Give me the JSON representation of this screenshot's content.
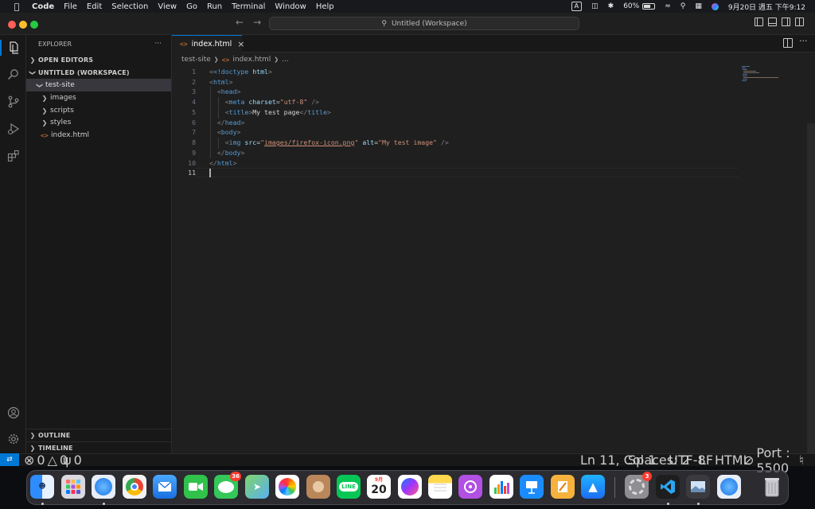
{
  "menubar": {
    "app": "Code",
    "items": [
      "File",
      "Edit",
      "Selection",
      "View",
      "Go",
      "Run",
      "Terminal",
      "Window",
      "Help"
    ],
    "input_source": "A",
    "battery": "60%",
    "datetime": "9月20日 週五 下午9:12"
  },
  "window": {
    "title": "Untitled (Workspace)"
  },
  "sidebar": {
    "title": "EXPLORER",
    "open_editors": "OPEN EDITORS",
    "workspace": "UNTITLED (WORKSPACE)",
    "tree": {
      "root": "test-site",
      "folders": [
        "images",
        "scripts",
        "styles"
      ],
      "file": "index.html"
    },
    "outline": "OUTLINE",
    "timeline": "TIMELINE"
  },
  "editor": {
    "tab": "index.html",
    "breadcrumb": {
      "folder": "test-site",
      "file": "index.html",
      "more": "..."
    },
    "line_numbers": [
      "1",
      "2",
      "3",
      "4",
      "5",
      "6",
      "7",
      "8",
      "9",
      "10",
      "11"
    ],
    "code": {
      "l1a": "<!doctype ",
      "l1b": "html",
      "l1c": ">",
      "l2": "html",
      "l3": "head",
      "l4_tag": "meta",
      "l4_attr": "charset",
      "l4_val": "\"utf-8\"",
      "l4_end": " />",
      "l5_tag": "title",
      "l5_text": "My test page",
      "l6": "head",
      "l7": "body",
      "l8_tag": "img",
      "l8_attr1": "src",
      "l8_val1a": "\"",
      "l8_val1b": "images/firefox-icon.png",
      "l8_val1c": "\"",
      "l8_attr2": "alt",
      "l8_val2": "\"My test image\"",
      "l8_end": " />",
      "l9": "body",
      "l10": "html"
    }
  },
  "status": {
    "errors": "0",
    "warnings": "0",
    "ports": "0",
    "position": "Ln 11, Col 1",
    "spaces": "Spaces: 2",
    "encoding": "UTF-8",
    "eol": "LF",
    "language": "HTML",
    "port": "Port : 5500"
  },
  "dock": {
    "calendar_month": "9月",
    "calendar_day": "20",
    "messages_badge": "36",
    "settings_badge": "3",
    "line_label": "LINE"
  },
  "colors": {
    "accent": "#0078d4",
    "tag": "#569cd6",
    "attr": "#9cdcfe",
    "string": "#ce9178"
  }
}
